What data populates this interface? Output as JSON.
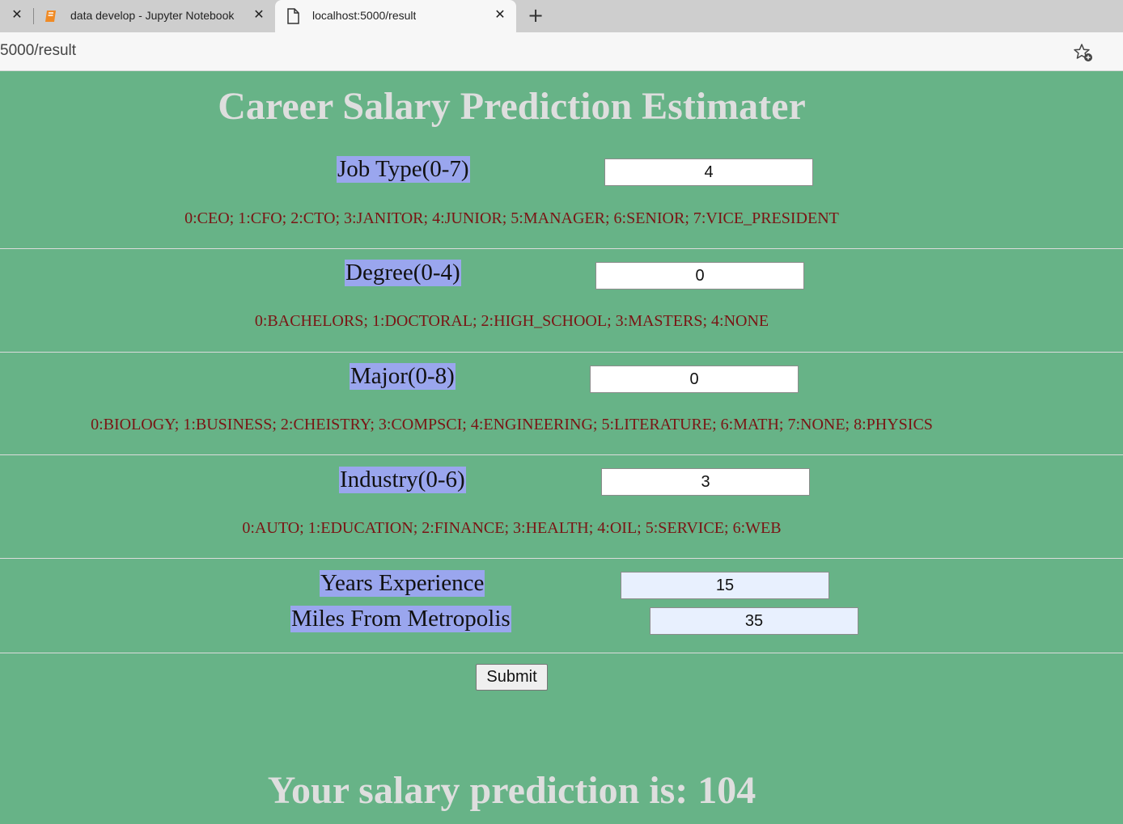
{
  "browser": {
    "tabs": [
      {
        "label": "data develop - Jupyter Notebook",
        "icon": "notebook-icon",
        "active": false
      },
      {
        "label": "localhost:5000/result",
        "icon": "page-icon",
        "active": true
      }
    ],
    "url": "5000/result"
  },
  "page": {
    "title": "Career Salary Prediction Estimater",
    "fields": [
      {
        "label": "Job Type(0-7)",
        "value": "4",
        "hint": "0:CEO; 1:CFO; 2:CTO; 3:JANITOR; 4:JUNIOR; 5:MANAGER; 6:SENIOR; 7:VICE_PRESIDENT"
      },
      {
        "label": "Degree(0-4)",
        "value": "0",
        "hint": "0:BACHELORS; 1:DOCTORAL; 2:HIGH_SCHOOL; 3:MASTERS; 4:NONE"
      },
      {
        "label": "Major(0-8)",
        "value": "0",
        "hint": "0:BIOLOGY; 1:BUSINESS; 2:CHEISTRY; 3:COMPSCI; 4:ENGINEERING; 5:LITERATURE; 6:MATH; 7:NONE; 8:PHYSICS"
      },
      {
        "label": "Industry(0-6)",
        "value": "3",
        "hint": "0:AUTO; 1:EDUCATION; 2:FINANCE; 3:HEALTH; 4:OIL; 5:SERVICE; 6:WEB"
      },
      {
        "label": "Years Experience",
        "value": "15"
      },
      {
        "label": "Miles From Metropolis",
        "value": "35"
      }
    ],
    "submit_label": "Submit",
    "result": "Your salary prediction is: 104"
  },
  "colors": {
    "background": "#67b387",
    "label_highlight": "#9aa6ee",
    "hint_text": "#7a1414",
    "heading_text": "#dedede"
  }
}
